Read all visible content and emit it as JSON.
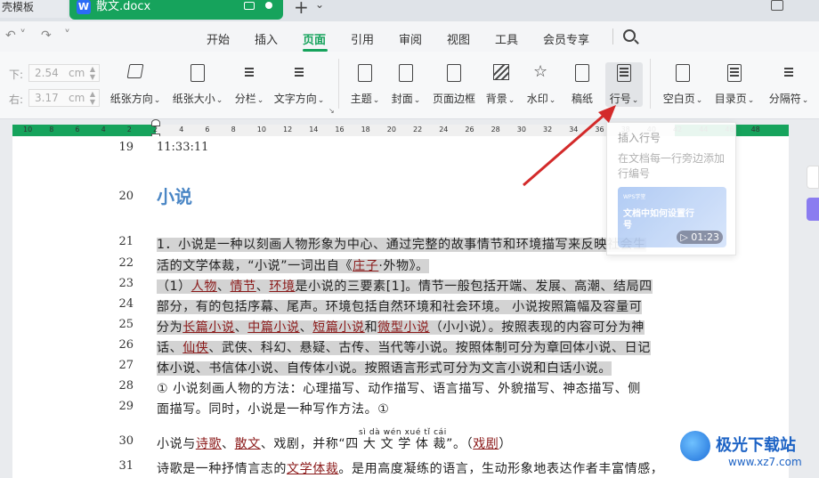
{
  "tabs": {
    "left_tab": "壳模板",
    "doc_tab": "散文.docx",
    "doc_icon": "W"
  },
  "menu": {
    "items": [
      "开始",
      "插入",
      "页面",
      "引用",
      "审阅",
      "视图",
      "工具",
      "会员专享"
    ],
    "active": "页面"
  },
  "ribbon": {
    "margin_bottom_label": "下:",
    "margin_bottom_value": "2.54",
    "margin_right_label": "右:",
    "margin_right_value": "3.17",
    "unit": "cm",
    "buttons": [
      "纸张方向",
      "纸张大小",
      "分栏",
      "文字方向",
      "主题",
      "封面",
      "页面边框",
      "背景",
      "水印",
      "稿纸",
      "行号",
      "空白页",
      "目录页",
      "分隔符"
    ]
  },
  "ruler": {
    "numbers": [
      "10",
      "8",
      "6",
      "4",
      "2",
      "2",
      "4",
      "6",
      "8",
      "10",
      "12",
      "14",
      "16",
      "18",
      "20",
      "22",
      "24",
      "26",
      "28",
      "30",
      "32",
      "34",
      "36",
      "38",
      "40",
      "42",
      "44",
      "46",
      "48"
    ]
  },
  "tooltip": {
    "title": "插入行号",
    "description": "在文档每一行旁边添加行编号",
    "video_small": "WPS学堂",
    "video_title": "文档中如何设置行号",
    "video_time": "01:23"
  },
  "document": {
    "time_text": "11:33:11",
    "line_numbers": [
      "19",
      "20",
      "21",
      "22",
      "23",
      "24",
      "25",
      "26",
      "27",
      "28",
      "29",
      "30",
      "31"
    ],
    "heading": "小说",
    "l21": "1．小说是一种以刻画人物形象为中心、通过完整的故事情节和环境描写来反映社会生",
    "l22a": "活的文学体裁，“小说”一词出自《",
    "l22_link": "庄子",
    "l22b": "·外物》。",
    "l23a": "（1）",
    "l23_link1": "人物",
    "l23_link2": "情节",
    "l23_link3": "环境",
    "l23b": "是小说的三要素[1]。情节一般包括开端、发展、高潮、结局四",
    "l24": "部分，有的包括序幕、尾声。环境包括自然环境和社会环境。 小说按照篇幅及容量可",
    "l25a": "分为",
    "l25_link1": "长篇小说",
    "l25_link2": "中篇小说",
    "l25_link3": "短篇小说",
    "l25_and": "和",
    "l25_link4": "微型小说",
    "l25b": "（小小说）。按照表现的内容可分为神",
    "l26a": "话、",
    "l26_link": "仙侠",
    "l26b": "、武侠、科幻、悬疑、古传、当代等小说。按照体制可分为章回体小说、日记",
    "l27": "体小说、书信体小说、自传体小说。按照语言形式可分为文言小说和白话小说。",
    "l28": "① 小说刻画人物的方法：心理描写、动作描写、语言描写、外貌描写、神态描写、侧",
    "l29": "面描写。同时，小说是一种写作方法。①",
    "l30a": "小说与",
    "l30_link1": "诗歌",
    "l30_link2": "散文",
    "l30b": "、戏剧，并称“",
    "l30_ruby": "四 大 文 学 体 裁",
    "l30_pinyin": "sì  dà  wén  xué  tǐ  cái",
    "l30c": "”。（",
    "l30_link3": "戏剧",
    "l30d": "）",
    "l31a": "诗歌是一种抒情言志的",
    "l31_link": "文学体裁",
    "l31b": "。是用高度凝练的语言，生动形象地表达作者丰富情感，"
  },
  "watermark": {
    "name": "极光下载站",
    "url": "www.xz7.com"
  },
  "colors": {
    "accent": "#16a35c",
    "heading": "#4a86c5",
    "link": "#8b1a1a",
    "arrow": "#d32a2a"
  }
}
